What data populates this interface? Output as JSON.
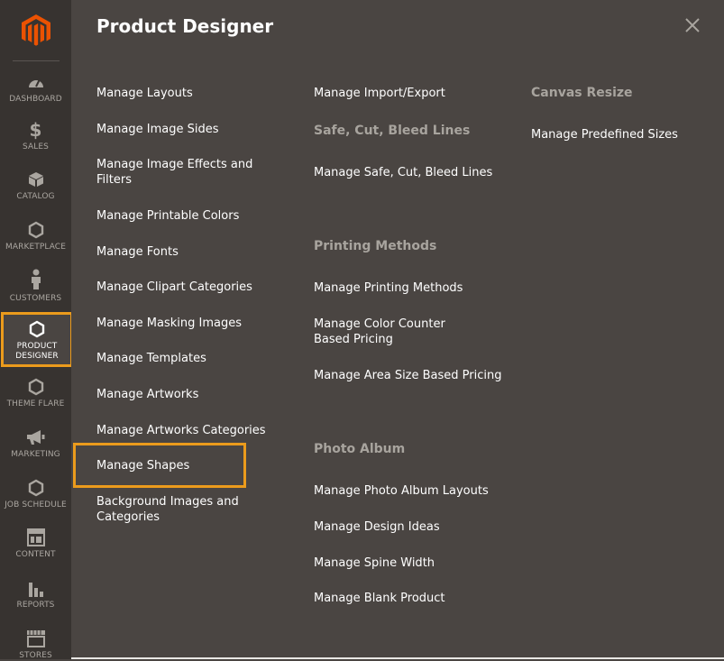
{
  "sidebar": {
    "items": [
      {
        "label": "DASHBOARD",
        "icon": "dashboard-icon"
      },
      {
        "label": "SALES",
        "icon": "dollar-icon"
      },
      {
        "label": "CATALOG",
        "icon": "box-icon"
      },
      {
        "label": "MARKETPLACE",
        "icon": "hexagon-icon"
      },
      {
        "label": "CUSTOMERS",
        "icon": "person-icon"
      },
      {
        "label": "PRODUCT DESIGNER",
        "icon": "hexagon-icon",
        "active": true
      },
      {
        "label": "THEME FLARE",
        "icon": "hexagon-icon"
      },
      {
        "label": "MARKETING",
        "icon": "megaphone-icon"
      },
      {
        "label": "JOB SCHEDULE",
        "icon": "hexagon-icon"
      },
      {
        "label": "CONTENT",
        "icon": "layout-icon"
      },
      {
        "label": "REPORTS",
        "icon": "bar-chart-icon"
      },
      {
        "label": "STORES",
        "icon": "store-icon"
      }
    ]
  },
  "panel": {
    "title": "Product Designer",
    "close_label": "×",
    "col1": [
      "Manage Layouts",
      "Manage Image Sides",
      "Manage Image Effects and Filters",
      "Manage Printable Colors",
      "Manage Fonts",
      "Manage Clipart Categories",
      "Manage Masking Images",
      "Manage Templates",
      "Manage Artworks",
      "Manage Artworks Categories",
      "Manage Shapes",
      "Background Images and Categories"
    ],
    "col2": {
      "link_import_export": "Manage Import/Export",
      "group_safe": "Safe, Cut, Bleed Lines",
      "link_safe": "Manage Safe, Cut, Bleed Lines",
      "group_printing": "Printing Methods",
      "link_printing": "Manage Printing Methods",
      "link_color_counter": "Manage Color Counter Based Pricing",
      "link_area_size": "Manage Area Size Based Pricing",
      "group_photo": "Photo Album",
      "link_photo_layouts": "Manage Photo Album Layouts",
      "link_design_ideas": "Manage Design Ideas",
      "link_spine": "Manage Spine Width",
      "link_blank": "Manage Blank Product"
    },
    "col3": {
      "group_canvas": "Canvas Resize",
      "link_predefined": "Manage Predefined Sizes"
    }
  },
  "colors": {
    "sidebar_bg": "#373330",
    "panel_bg": "#4a4542",
    "accent": "#eb9b1c",
    "logo": "#eb5202"
  }
}
